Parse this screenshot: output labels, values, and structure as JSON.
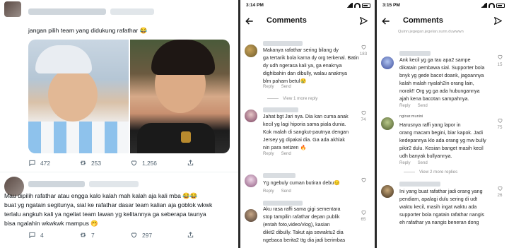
{
  "twitter": {
    "tweet1": {
      "text": "jangan pilih team yang didukung rafathar 😂",
      "actions": {
        "replies": "472",
        "retweets": "253",
        "likes": "1,256"
      }
    },
    "tweet2": {
      "lines": [
        "Mau dipilih rafathar atau engga kalo kalah mah kalah aja kali mba 😂😂",
        "buat yg ngatain segitunya, sial ke rafathar dasar team kalian aja goblok wkwk",
        "terlalu angkuh kali ya ngeliat team lawan yg kelitannya ga seberapa taunya",
        "bisa ngalahin wkwkwk mampus 🤭"
      ],
      "actions": {
        "replies": "4",
        "retweets": "7",
        "likes": "297"
      }
    }
  },
  "ig_left": {
    "time": "3:14 PM",
    "title": "Comments",
    "comments": [
      {
        "lines": [
          "Makanya rafathar sering bilang dy",
          "ga tertarik bola karna dy org terkenal. Batin",
          "dy udh ngerasa kali ya, ga enaknya",
          "dighibahin dan dibully, walau anaknya",
          "blm paham betul😢"
        ],
        "likes": "183",
        "reply": "Reply",
        "send": "Send",
        "more": "View 1 more reply"
      },
      {
        "lines": [
          "Jahat bgt Jari nya. Dia kan cuma anak",
          "kecil yg lagi hiporia sama piala dunia.",
          "Kok malah di sangkut-pautnya dengan",
          "Jersey yg dipakai dia. Ga ada akhlak",
          "nin para netizen 🔥"
        ],
        "likes": "74",
        "reply": "Reply",
        "send": "Send"
      },
      {
        "lines": [
          "Yg ngebuly cuman butiran debu😔"
        ],
        "likes": "",
        "reply": "Reply",
        "send": "Send"
      },
      {
        "lines": [
          "Aku rasa raffi sama gigi sementara",
          "stop tampilin rafathar depan publik",
          "(entah foto,video/vlog), kasian",
          "dikit2 dibully. Takut aja sewaktu2 dia",
          "ngebaca berita2 ttg dia jadi berimbas"
        ],
        "likes": "65",
        "reply": "",
        "send": ""
      }
    ]
  },
  "ig_right": {
    "time": "3:15 PM",
    "title": "Comments",
    "top_partial": "Quinn.jegegan.jegelan.sunn.duwwwn",
    "comments": [
      {
        "lines": [
          "Ank kecil yg ga tau apa2 sampe",
          "dikatain pembawa sial. Supporter bola",
          "bnyk yg gede bacot doank, jagoannya",
          "kalah malah nyalah2in orang lain,",
          "norak!! Org yg ga ada hubungannya",
          "ajah kena bacotan sampahnya."
        ],
        "likes": "15",
        "reply": "Reply",
        "send": "Send"
      },
      {
        "name": "nginar.munini",
        "lines": [
          "Harusnya raffi yang lapor in",
          "orang macam begini, biar kapok. Jadi",
          "kedepannya klo ada orang yg mw bully",
          "pikir2 dulu. Kesian banget masih kecil",
          "udh banyak bullyannya."
        ],
        "likes": "75",
        "reply": "Reply",
        "send": "Send",
        "more": "View 2 more replies"
      },
      {
        "lines": [
          "Ini yang buat rafathar jadi orang yang",
          "pendiam, apalagi dulu sering di udt",
          "waktu kecil, masih ingat waktu ada",
          "supporter bola ngatain rafathar nangis",
          "eh rafathar ya nangis beneran dong"
        ],
        "likes": "26",
        "reply": "",
        "send": ""
      }
    ]
  }
}
